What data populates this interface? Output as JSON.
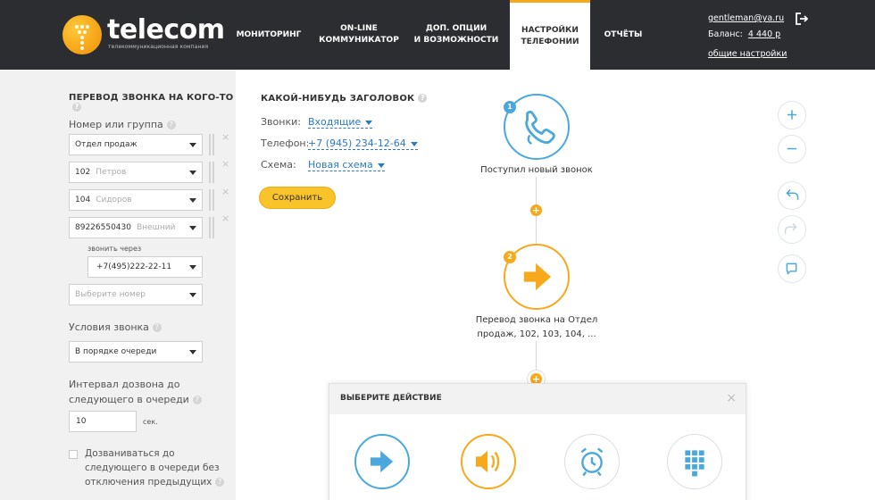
{
  "brand": {
    "name": "telecom",
    "tagline": "телекоммуникационная компания"
  },
  "nav": [
    {
      "label": "МОНИТОРИНГ"
    },
    {
      "label_line1": "ON-LINE",
      "label_line2": "КОММУНИКАТОР"
    },
    {
      "label_line1": "ДОП. ОПЦИИ",
      "label_line2": "И ВОЗМОЖНОСТИ"
    },
    {
      "label_line1": "НАСТРОЙКИ",
      "label_line2": "ТЕЛЕФОНИИ"
    },
    {
      "label": "ОТЧЁТЫ"
    }
  ],
  "user": {
    "email": "gentleman@ya.ru",
    "balance_label": "Баланс:",
    "balance_value": "4 440 р",
    "settings_link": "общие настройки"
  },
  "left": {
    "title": "ПЕРЕВОД ЗВОНКА НА КОГО-ТО",
    "number_group_label": "Номер или группа",
    "rows": [
      {
        "value": "Отдел продаж",
        "hint": ""
      },
      {
        "value": "102",
        "hint": "Петров"
      },
      {
        "value": "104",
        "hint": "Сидоров"
      },
      {
        "value": "89226550430",
        "hint": "Внешний"
      }
    ],
    "call_via_label": "звонить через",
    "call_via_value": "+7(495)222-22-11",
    "choose_number_placeholder": "Выберите номер",
    "conditions_label": "Условия звонка",
    "conditions_value": "В порядке очереди",
    "interval_label_1": "Интервал дозвона до",
    "interval_label_2": "следующего в очереди",
    "interval_value": "10",
    "interval_unit": "сек.",
    "checkbox_label_1": "Дозваниваться до",
    "checkbox_label_2": "следующего в очереди без",
    "checkbox_label_3": "отключения предыдущих"
  },
  "settings": {
    "title": "КАКОЙ-НИБУДЬ ЗАГОЛОВОК",
    "calls_label": "Звонки:",
    "calls_value": "Входящие",
    "phone_label": "Телефон:",
    "phone_value": "+7 (945) 234-12-64",
    "scheme_label": "Схема:",
    "scheme_value": "Новая схема",
    "save_label": "Сохранить"
  },
  "flow": {
    "node1": {
      "badge": "1",
      "caption": "Поступил новый звонок"
    },
    "node2": {
      "badge": "2",
      "caption_1": "Перевод звонка на Отдел",
      "caption_2": "продаж, 102, 103, 104, ..."
    },
    "add_symbol": "+"
  },
  "popup": {
    "title": "ВЫБЕРИТЕ ДЕЙСТВИЕ",
    "close_symbol": "×"
  },
  "colors": {
    "header": "#2b2d31",
    "accent": "#f7a81b",
    "blue": "#4aa8dc",
    "left_bg": "#f1f1f1"
  }
}
